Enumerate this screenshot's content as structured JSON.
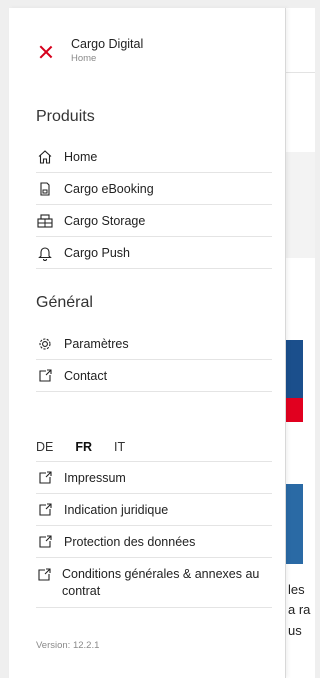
{
  "header": {
    "title": "Cargo Digital",
    "subtitle": "Home"
  },
  "sections": {
    "produits": {
      "title": "Produits",
      "items": [
        {
          "label": "Home",
          "icon": "home-icon"
        },
        {
          "label": "Cargo eBooking",
          "icon": "document-icon"
        },
        {
          "label": "Cargo Storage",
          "icon": "storage-icon"
        },
        {
          "label": "Cargo Push",
          "icon": "bell-icon"
        }
      ]
    },
    "general": {
      "title": "Général",
      "items": [
        {
          "label": "Paramètres",
          "icon": "gear-icon"
        },
        {
          "label": "Contact",
          "icon": "external-link-icon"
        }
      ]
    }
  },
  "languages": {
    "options": [
      "DE",
      "FR",
      "IT"
    ],
    "selected": "FR"
  },
  "legal": {
    "items": [
      {
        "label": "Impressum",
        "icon": "external-link-icon"
      },
      {
        "label": "Indication juridique",
        "icon": "external-link-icon"
      },
      {
        "label": "Protection des données",
        "icon": "external-link-icon"
      },
      {
        "label": "Conditions générales & annexes au contrat",
        "icon": "external-link-icon"
      }
    ]
  },
  "version": "Version: 12.2.1",
  "background": {
    "text_lines": [
      "les",
      "a ra",
      "us"
    ]
  },
  "colors": {
    "accent": "#d6001c",
    "brand_blue": "#1b4f8c",
    "brand_red": "#e1001f"
  }
}
